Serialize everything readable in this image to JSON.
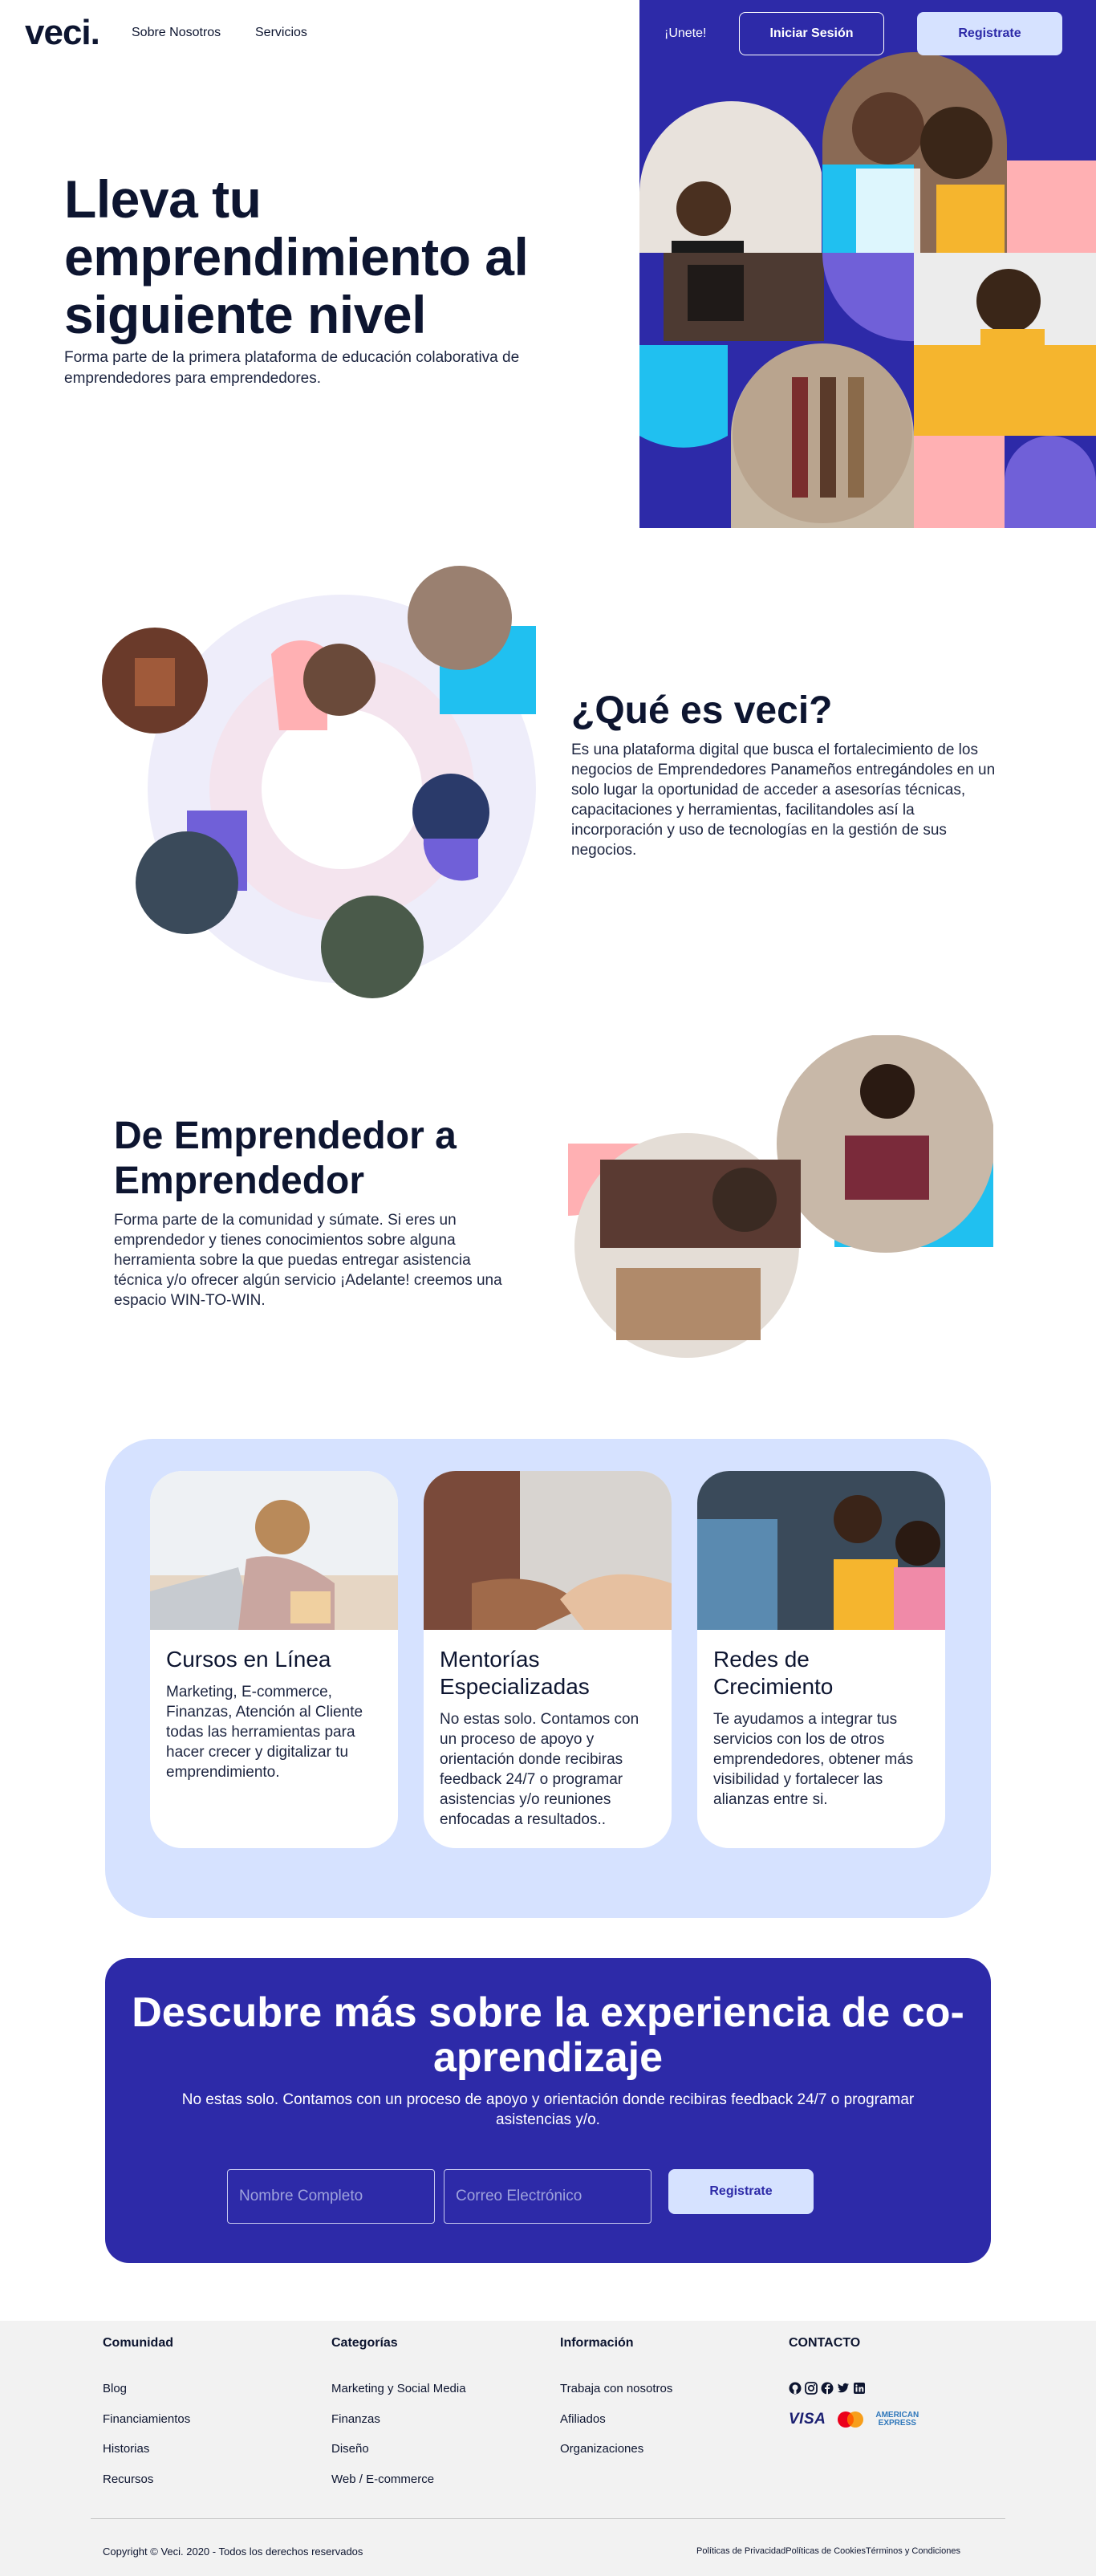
{
  "header": {
    "logo": "veci.",
    "nav": [
      "Sobre Nosotros",
      "Servicios"
    ],
    "join_label": "¡Unete!",
    "login_label": "Iniciar Sesión",
    "register_label": "Registrate"
  },
  "hero": {
    "title": "Lleva tu emprendimiento al siguiente nivel",
    "subtitle": "Forma parte de la primera plataforma de educación colaborativa de emprendedores para emprendedores."
  },
  "about": {
    "title": "¿Qué es veci?",
    "body": "Es una plataforma digital que busca el fortalecimiento de los negocios de Emprendedores Panameños entregándoles en un solo lugar la oportunidad de acceder a asesorías técnicas, capacitaciones y herramientas, facilitandoles así la incorporación y uso de tecnologías en la gestión de sus negocios."
  },
  "community": {
    "title": "De Emprendedor a Emprendedor",
    "body": "Forma parte de la comunidad y súmate. Si eres un emprendedor y tienes conocimientos sobre alguna herramienta sobre la que puedas entregar asistencia técnica y/o ofrecer algún servicio ¡Adelante! creemos una espacio WIN-TO-WIN."
  },
  "features": [
    {
      "title": "Cursos en Línea",
      "body": "Marketing, E-commerce, Finanzas, Atención al Cliente todas las herramientas para hacer crecer y digitalizar tu emprendimiento."
    },
    {
      "title": "Mentorías Especializadas",
      "body": "No estas solo. Contamos con un proceso de apoyo y orientación donde recibiras feedback 24/7 o programar asistencias y/o reuniones enfocadas a resultados.."
    },
    {
      "title": "Redes de Crecimiento",
      "body": "Te ayudamos a integrar tus servicios con los de otros emprendedores, obtener más visibilidad y fortalecer las alianzas entre si."
    }
  ],
  "cta": {
    "title": "Descubre más sobre la experiencia de co-aprendizaje",
    "subtitle": "No estas solo. Contamos con un proceso de apoyo y orientación donde recibiras feedback 24/7 o programar asistencias y/o.",
    "name_placeholder": "Nombre Completo",
    "email_placeholder": "Correo Electrónico",
    "button_label": "Registrate"
  },
  "footer": {
    "columns": [
      {
        "title": "Comunidad",
        "links": [
          "Blog",
          "Financiamientos",
          "Historias",
          "Recursos"
        ]
      },
      {
        "title": "Categorías",
        "links": [
          "Marketing y Social Media",
          "Finanzas",
          "Diseño",
          "Web / E-commerce"
        ]
      },
      {
        "title": "Información",
        "links": [
          "Trabaja con nosotros",
          "Afiliados",
          "Organizaciones"
        ]
      },
      {
        "title": "CONTACTO"
      }
    ],
    "social_icons": [
      "github-icon",
      "instagram-icon",
      "facebook-icon",
      "twitter-icon",
      "linkedin-icon"
    ],
    "payment": {
      "visa": "VISA",
      "amex_line1": "AMERICAN",
      "amex_line2": "EXPRESS"
    },
    "copyright": "Copyright © Veci. 2020 - Todos los derechos reservados",
    "legal": [
      "Políticas de Privacidad",
      "Políticas de Cookies",
      "Términos y Condiciones"
    ]
  },
  "colors": {
    "brand_indigo": "#2d2aa8",
    "light_blue": "#d6e2ff",
    "pink": "#ffb0b3",
    "cyan": "#20c0f0",
    "violet": "#7060d8",
    "yellow": "#f5b52e",
    "text_dark": "#0d1530"
  }
}
